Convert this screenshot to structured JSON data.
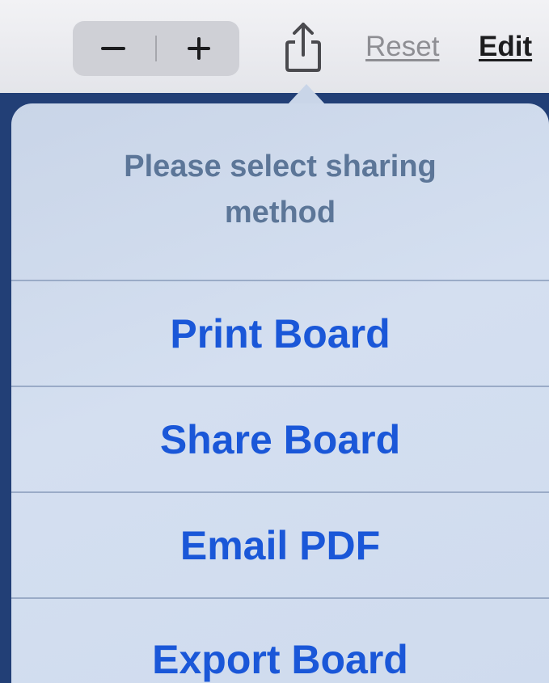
{
  "toolbar": {
    "zoom_out_icon": "minus-icon",
    "zoom_in_icon": "plus-icon",
    "share_icon": "share-icon",
    "reset_label": "Reset",
    "edit_label": "Edit"
  },
  "share_sheet": {
    "title": "Please select sharing method",
    "options": [
      {
        "label": "Print Board"
      },
      {
        "label": "Share Board"
      },
      {
        "label": "Email PDF"
      },
      {
        "label": "Export Board"
      }
    ]
  },
  "colors": {
    "accent": "#1a57d8",
    "title": "#5c7698",
    "app_background": "#223f76"
  }
}
